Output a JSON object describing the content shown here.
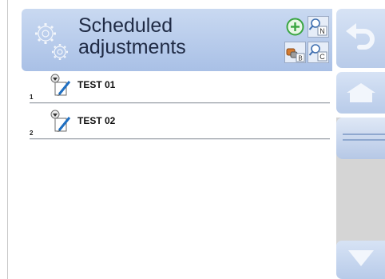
{
  "header": {
    "title_line1": "Scheduled",
    "title_line2": "adjustments",
    "icon": "gears-icon",
    "buttons": [
      {
        "name": "add-button",
        "icon": "plus-circle-icon"
      },
      {
        "name": "search-by-name-button",
        "icon": "search-n-icon",
        "letter": "N"
      },
      {
        "name": "filter-button",
        "icon": "weights-filter-icon",
        "letter": "B"
      },
      {
        "name": "search-by-code-button",
        "icon": "search-c-icon",
        "letter": "C"
      }
    ]
  },
  "adjustments": [
    {
      "number": "1",
      "name": "TEST 01"
    },
    {
      "number": "2",
      "name": "TEST 02"
    }
  ],
  "sidebar": {
    "back": {
      "icon": "undo-arrow-icon"
    },
    "home": {
      "icon": "home-icon"
    },
    "scroll_down": {
      "icon": "arrow-down-icon"
    }
  },
  "colors": {
    "header_bg": "#b8cceb",
    "panel_bg": "#c7d6ef",
    "track_bg": "#d5d5d5",
    "title_text": "#1f2a44"
  }
}
